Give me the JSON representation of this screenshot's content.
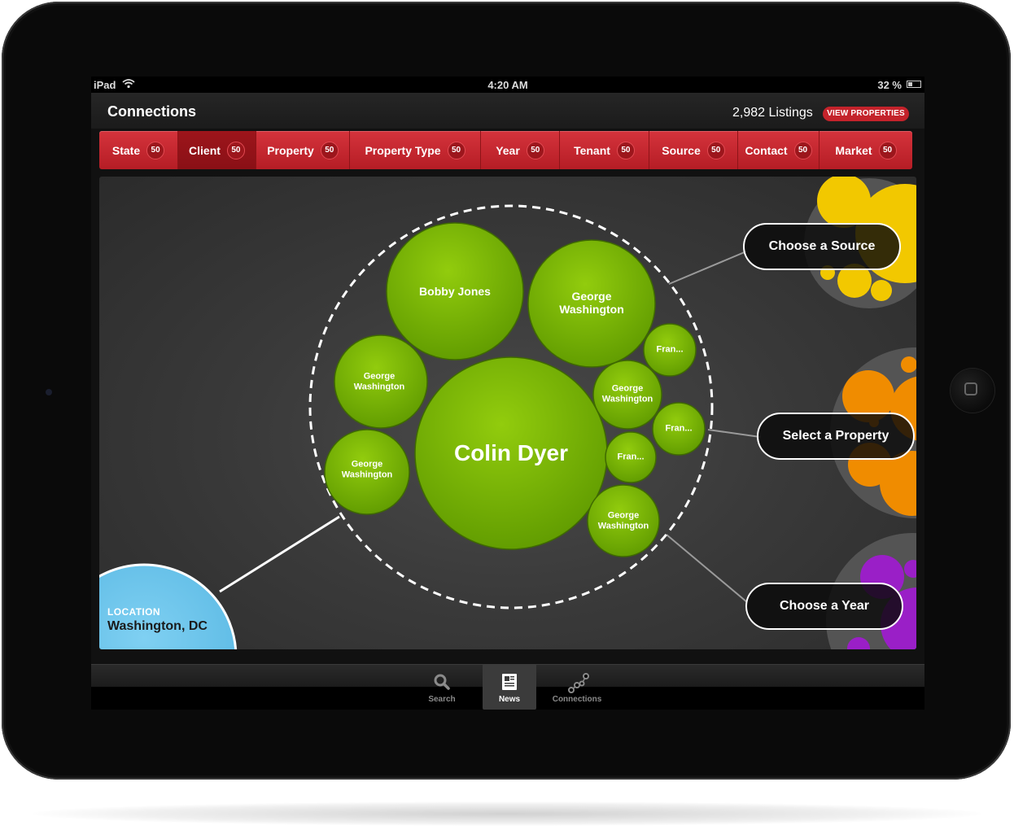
{
  "status_bar": {
    "device": "iPad",
    "time": "4:20 AM",
    "battery": "32 %"
  },
  "header": {
    "title": "Connections",
    "listings": "2,982 Listings",
    "view_button": "VIEW PROPERTIES"
  },
  "tabs": [
    {
      "label": "State",
      "count": "50"
    },
    {
      "label": "Client",
      "count": "50"
    },
    {
      "label": "Property",
      "count": "50"
    },
    {
      "label": "Property Type",
      "count": "50"
    },
    {
      "label": "Year",
      "count": "50"
    },
    {
      "label": "Tenant",
      "count": "50"
    },
    {
      "label": "Source",
      "count": "50"
    },
    {
      "label": "Contact",
      "count": "50"
    },
    {
      "label": "Market",
      "count": "50"
    }
  ],
  "active_tab": "Client",
  "bubbles": {
    "center": "Colin Dyer",
    "b1": "Bobby Jones",
    "b2": "George Washington",
    "b3": "George Washington",
    "b4": "George Washington",
    "b5": "George Washington",
    "b6": "George Washington",
    "f1": "Fran...",
    "f2": "Fran...",
    "f3": "Fran..."
  },
  "pills": {
    "source": "Choose a Source",
    "property": "Select a Property",
    "year": "Choose a Year"
  },
  "location": {
    "label": "LOCATION",
    "value": "Washington, DC"
  },
  "tabbar": [
    {
      "label": "Search",
      "icon": "search-icon"
    },
    {
      "label": "News",
      "icon": "news-icon"
    },
    {
      "label": "Connections",
      "icon": "connections-icon"
    }
  ],
  "colors": {
    "accent_red": "#c4232b",
    "bubble_green": "#7ab800",
    "location_blue": "#6cc3ea",
    "yellow": "#f2c800",
    "orange": "#f08c00",
    "purple": "#9a1fc7"
  }
}
